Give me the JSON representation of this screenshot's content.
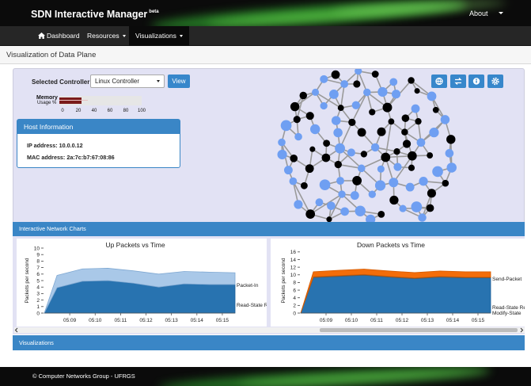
{
  "header": {
    "brand": "SDN Interactive Manager",
    "brand_sup": "beta",
    "about": "About"
  },
  "nav": {
    "dashboard": "Dashboard",
    "resources": "Resources",
    "visualizations": "Visualizations"
  },
  "page": {
    "subtitle": "Visualization of Data Plane"
  },
  "controller": {
    "label": "Selected Controller:",
    "selected": "Linux Controller",
    "view_button": "View"
  },
  "memory": {
    "label": "Memory",
    "sublabel": "Usage %",
    "ticks": [
      "0",
      "20",
      "40",
      "60",
      "80",
      "100"
    ],
    "value_percent": 27
  },
  "host": {
    "title": "Host Information",
    "ip": "IP address: 10.0.0.12",
    "mac": "MAC address: 2a:7c:b7:67:08:86"
  },
  "toolbar_icons": [
    "globe-icon",
    "exchange-icon",
    "info-icon",
    "gear-icon"
  ],
  "charts": {
    "header": "Interactive Network Charts",
    "visualizations_header": "Visualizations"
  },
  "footer": {
    "text": "© Computer Networks Group - UFRGS"
  },
  "colors": {
    "accent": "#3a86c6",
    "light_node": "#6f9ff2",
    "dark_node": "#000000",
    "area_dark": "#2873b0",
    "area_light": "#a9c8e8",
    "area_orange": "#f36d0a"
  },
  "chart_data": [
    {
      "type": "area",
      "title": "Up Packets vs Time",
      "ylabel": "Packets per second",
      "xlabel": "",
      "x": [
        "05:09",
        "05:10",
        "05:11",
        "05:12",
        "05:13",
        "05:14",
        "05:15"
      ],
      "ylim": [
        0,
        10
      ],
      "yticks": [
        "0",
        "1",
        "2",
        "3",
        "4",
        "5",
        "6",
        "7",
        "8",
        "9",
        "10"
      ],
      "points": [
        0,
        0.5,
        1.5,
        2.5,
        3.5,
        4.5,
        5.5,
        6.5,
        7.5
      ],
      "series": [
        {
          "name": "Read-State Reply",
          "values": [
            0,
            3.9,
            4.9,
            5.0,
            4.6,
            4.0,
            4.5,
            4.4,
            4.4
          ]
        },
        {
          "name": "Packet-In",
          "values": [
            0,
            1.9,
            1.9,
            1.9,
            1.9,
            2.0,
            1.9,
            1.9,
            1.8
          ]
        }
      ]
    },
    {
      "type": "area",
      "title": "Down Packets vs Time",
      "ylabel": "Packets per second",
      "xlabel": "",
      "x": [
        "05:09",
        "05:10",
        "05:11",
        "05:12",
        "05:13",
        "05:14",
        "05:15"
      ],
      "ylim": [
        0,
        17
      ],
      "yticks": [
        "0",
        "2",
        "4",
        "6",
        "8",
        "10",
        "12",
        "14",
        "16"
      ],
      "points": [
        0,
        0.5,
        1.5,
        2.5,
        3.5,
        4.5,
        5.5,
        6.5,
        7.5
      ],
      "series": [
        {
          "name": "Read-State Reply",
          "values": [
            0,
            9.3,
            9.6,
            9.9,
            9.4,
            9.0,
            9.4,
            9.2,
            9.2
          ]
        },
        {
          "name": "Modify-State",
          "values": [
            0,
            0.2,
            0.2,
            0.2,
            0.2,
            0.2,
            0.2,
            0.2,
            0.2
          ]
        },
        {
          "name": "Send-Packet",
          "values": [
            0,
            1.3,
            1.4,
            1.4,
            1.4,
            1.4,
            1.4,
            1.4,
            1.4
          ]
        }
      ]
    }
  ]
}
